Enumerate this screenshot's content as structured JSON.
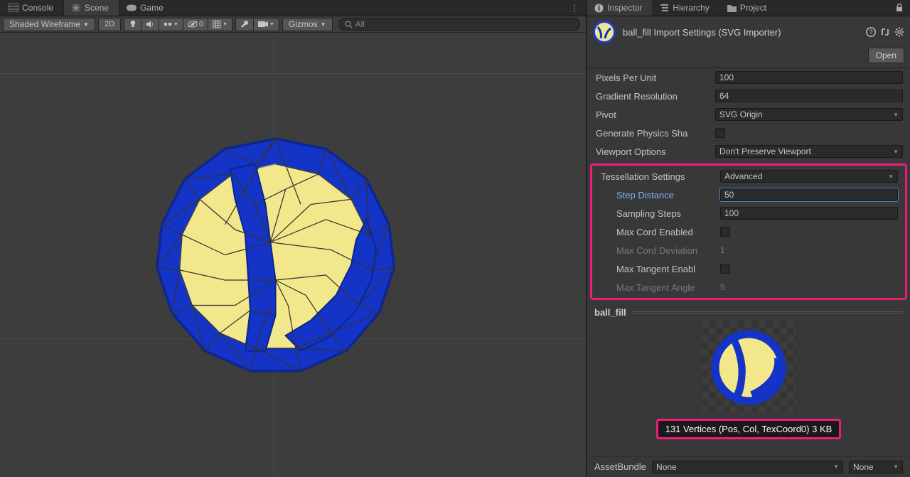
{
  "left": {
    "tabs": {
      "console": "Console",
      "scene": "Scene",
      "game": "Game"
    },
    "shading_mode": "Shaded Wireframe",
    "dim_mode": "2D",
    "hidden_count": "0",
    "gizmos_label": "Gizmos",
    "search_placeholder": "All"
  },
  "right": {
    "tabs": {
      "inspector": "Inspector",
      "hierarchy": "Hierarchy",
      "project": "Project"
    },
    "asset_title": "ball_fill Import Settings (SVG Importer)",
    "open_button": "Open",
    "props": {
      "pixels_per_unit_label": "Pixels Per Unit",
      "pixels_per_unit_value": "100",
      "gradient_resolution_label": "Gradient Resolution",
      "gradient_resolution_value": "64",
      "pivot_label": "Pivot",
      "pivot_value": "SVG Origin",
      "generate_physics_label": "Generate Physics Sha",
      "viewport_options_label": "Viewport Options",
      "viewport_options_value": "Don't Preserve Viewport"
    },
    "tess": {
      "title_label": "Tessellation Settings",
      "title_value": "Advanced",
      "step_distance_label": "Step Distance",
      "step_distance_value": "50",
      "sampling_steps_label": "Sampling Steps",
      "sampling_steps_value": "100",
      "max_cord_enabled_label": "Max Cord Enabled",
      "max_cord_deviation_label": "Max Cord Deviation",
      "max_cord_deviation_value": "1",
      "max_tangent_enabled_label": "Max Tangent Enabl",
      "max_tangent_angle_label": "Max Tangent Angle",
      "max_tangent_angle_value": "5"
    },
    "preview": {
      "name": "ball_fill",
      "stats": "131 Vertices (Pos, Col, TexCoord0) 3 KB"
    },
    "asset_bundle_label": "AssetBundle",
    "asset_bundle_value": "None",
    "asset_bundle_variant": "None"
  }
}
